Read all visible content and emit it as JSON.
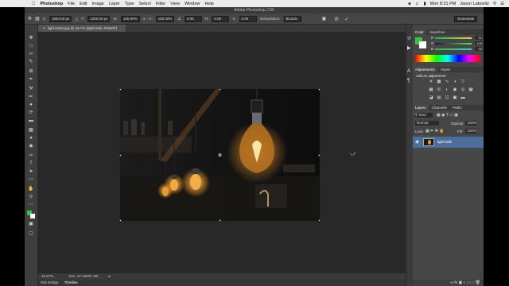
{
  "menubar": {
    "app": "Photoshop",
    "items": [
      "File",
      "Edit",
      "Image",
      "Layer",
      "Type",
      "Select",
      "Filter",
      "View",
      "Window",
      "Help"
    ],
    "clock": "Mon 8:31 PM",
    "user": "Jason Labovitz"
  },
  "window": {
    "title": "Adobe Photoshop CS6"
  },
  "options": {
    "x_label": "X:",
    "x_value": "1584.50 px",
    "y_label": "Y:",
    "y_value": "1256.50 px",
    "w_label": "W:",
    "w_value": "100.00%",
    "h_label": "H:",
    "h_value": "100.00%",
    "angle_value": "0.00",
    "hskew_label": "H:",
    "hskew_value": "0.00",
    "vskew_label": "V:",
    "vskew_value": "0.00",
    "interp_label": "Interpolation:",
    "interp_value": "Bicubic",
    "workspace": "Essentials"
  },
  "document": {
    "tab_label": "light bulbs.jpg @ 16.7% (light bulb, RGB/8*)",
    "zoom": "16.67%",
    "doc_info": "Doc: 37.1M/37.1M"
  },
  "bottom_tabs": [
    "Mini Bridge",
    "Timeline"
  ],
  "color_panel": {
    "tabs": [
      "Color",
      "Swatches"
    ],
    "channels": [
      {
        "label": "R",
        "value": "51"
      },
      {
        "label": "G",
        "value": "198"
      },
      {
        "label": "B",
        "value": "66"
      }
    ],
    "foreground": "#33c642",
    "background": "#ffffff"
  },
  "adjustments_panel": {
    "tabs": [
      "Adjustments",
      "Styles"
    ],
    "heading": "Add an adjustment"
  },
  "layers_panel": {
    "tabs": [
      "Layers",
      "Channels",
      "Paths"
    ],
    "filter_label": "Kind",
    "blend_mode": "Normal",
    "opacity_label": "Opacity:",
    "opacity_value": "100%",
    "lock_label": "Lock:",
    "fill_label": "Fill:",
    "fill_value": "100%",
    "layers": [
      {
        "name": "light bulb"
      }
    ]
  },
  "colors": {
    "accent_selected_layer": "#4d6d9a",
    "panel_bg": "#464646",
    "canvas_bg": "#282828"
  }
}
